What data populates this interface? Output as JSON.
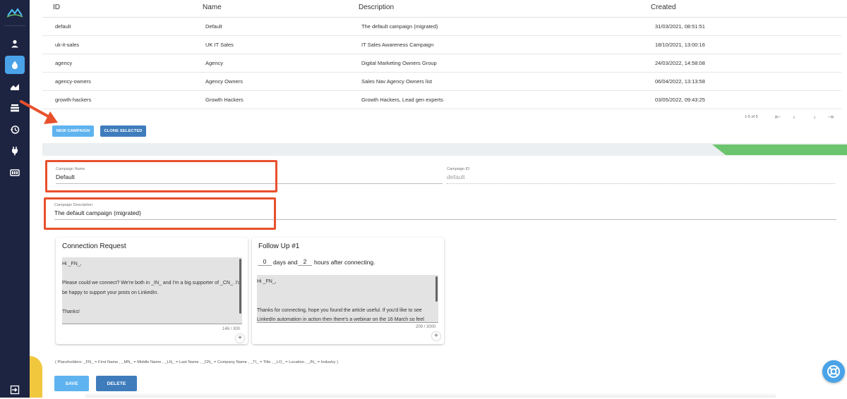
{
  "table": {
    "headers": {
      "id": "ID",
      "name": "Name",
      "description": "Description",
      "created": "Created"
    },
    "rows": [
      {
        "id": "default",
        "name": "Default",
        "description": "The default campaign (migrated)",
        "created": "31/03/2021, 08:51:51"
      },
      {
        "id": "uk-it-sales",
        "name": "UK IT Sales",
        "description": "IT Sales Awareness Campaign",
        "created": "18/10/2021, 13:00:16"
      },
      {
        "id": "agency",
        "name": "Agency",
        "description": "Digital Marketing Owners Group",
        "created": "24/03/2022, 14:58:08"
      },
      {
        "id": "agency-owners",
        "name": "Agency Owners",
        "description": "Sales Nav Agency Owners list",
        "created": "06/04/2022, 13:13:58"
      },
      {
        "id": "growth-hackers",
        "name": "Growth Hackers",
        "description": "Growth Hackers, Lead gen experts",
        "created": "03/05/2022, 09:43:25"
      }
    ],
    "pagination_text": "1-5 of 5",
    "new_campaign_label": "NEW CAMPAIGN",
    "clone_selected_label": "CLONE SELECTED"
  },
  "form": {
    "campaign_name": {
      "label": "Campaign Name",
      "value": "Default"
    },
    "campaign_id": {
      "label": "Campaign ID",
      "value": "default"
    },
    "campaign_description": {
      "label": "Campaign Description",
      "value": "The default campaign (migrated)"
    }
  },
  "connection_card": {
    "title": "Connection Request",
    "message": "Hi _FN_,\n\nPlease could we connect? We're both in _IN_ and I'm a big supporter of _CN_. I'd be happy to support your posts on LinkedIn.\n\nThanks!",
    "counter": "146 / 300"
  },
  "followup_card": {
    "title": "Follow Up #1",
    "days_value": "0",
    "days_label": "days and",
    "hours_value": "2",
    "hours_label": "hours after connecting.",
    "message": "Hi _FN_,\n\n\nThanks for connecting, hope you found the article useful. If you'd like to see LinkedIn automation in action then there's a webinar on the 16 March so feel",
    "counter": "209 / 3000"
  },
  "placeholders_help": "( Placeholders: _FN_ = First Name , _MN_ = Middle Name , _LN_ = Last Name , _CN_ = Company Name , _TI_ = Title , _LO_ = Location , _IN_ = Industry )",
  "actions": {
    "save_label": "SAVE",
    "delete_label": "DELETE"
  },
  "colors": {
    "sidebar_bg": "#1d2441",
    "primary": "#5fb3ef",
    "secondary": "#3f7cbc",
    "annotation_red": "#e8502c",
    "accent_green": "#6cc56e",
    "accent_yellow": "#f1c73d"
  },
  "sidebar": {
    "items": [
      {
        "icon": "logo-icon"
      },
      {
        "icon": "user-icon"
      },
      {
        "icon": "drop-icon",
        "active": true
      },
      {
        "icon": "chart-icon"
      },
      {
        "icon": "stack-icon"
      },
      {
        "icon": "history-icon"
      },
      {
        "icon": "plug-icon"
      },
      {
        "icon": "grid-icon"
      },
      {
        "icon": "logout-icon"
      }
    ]
  }
}
